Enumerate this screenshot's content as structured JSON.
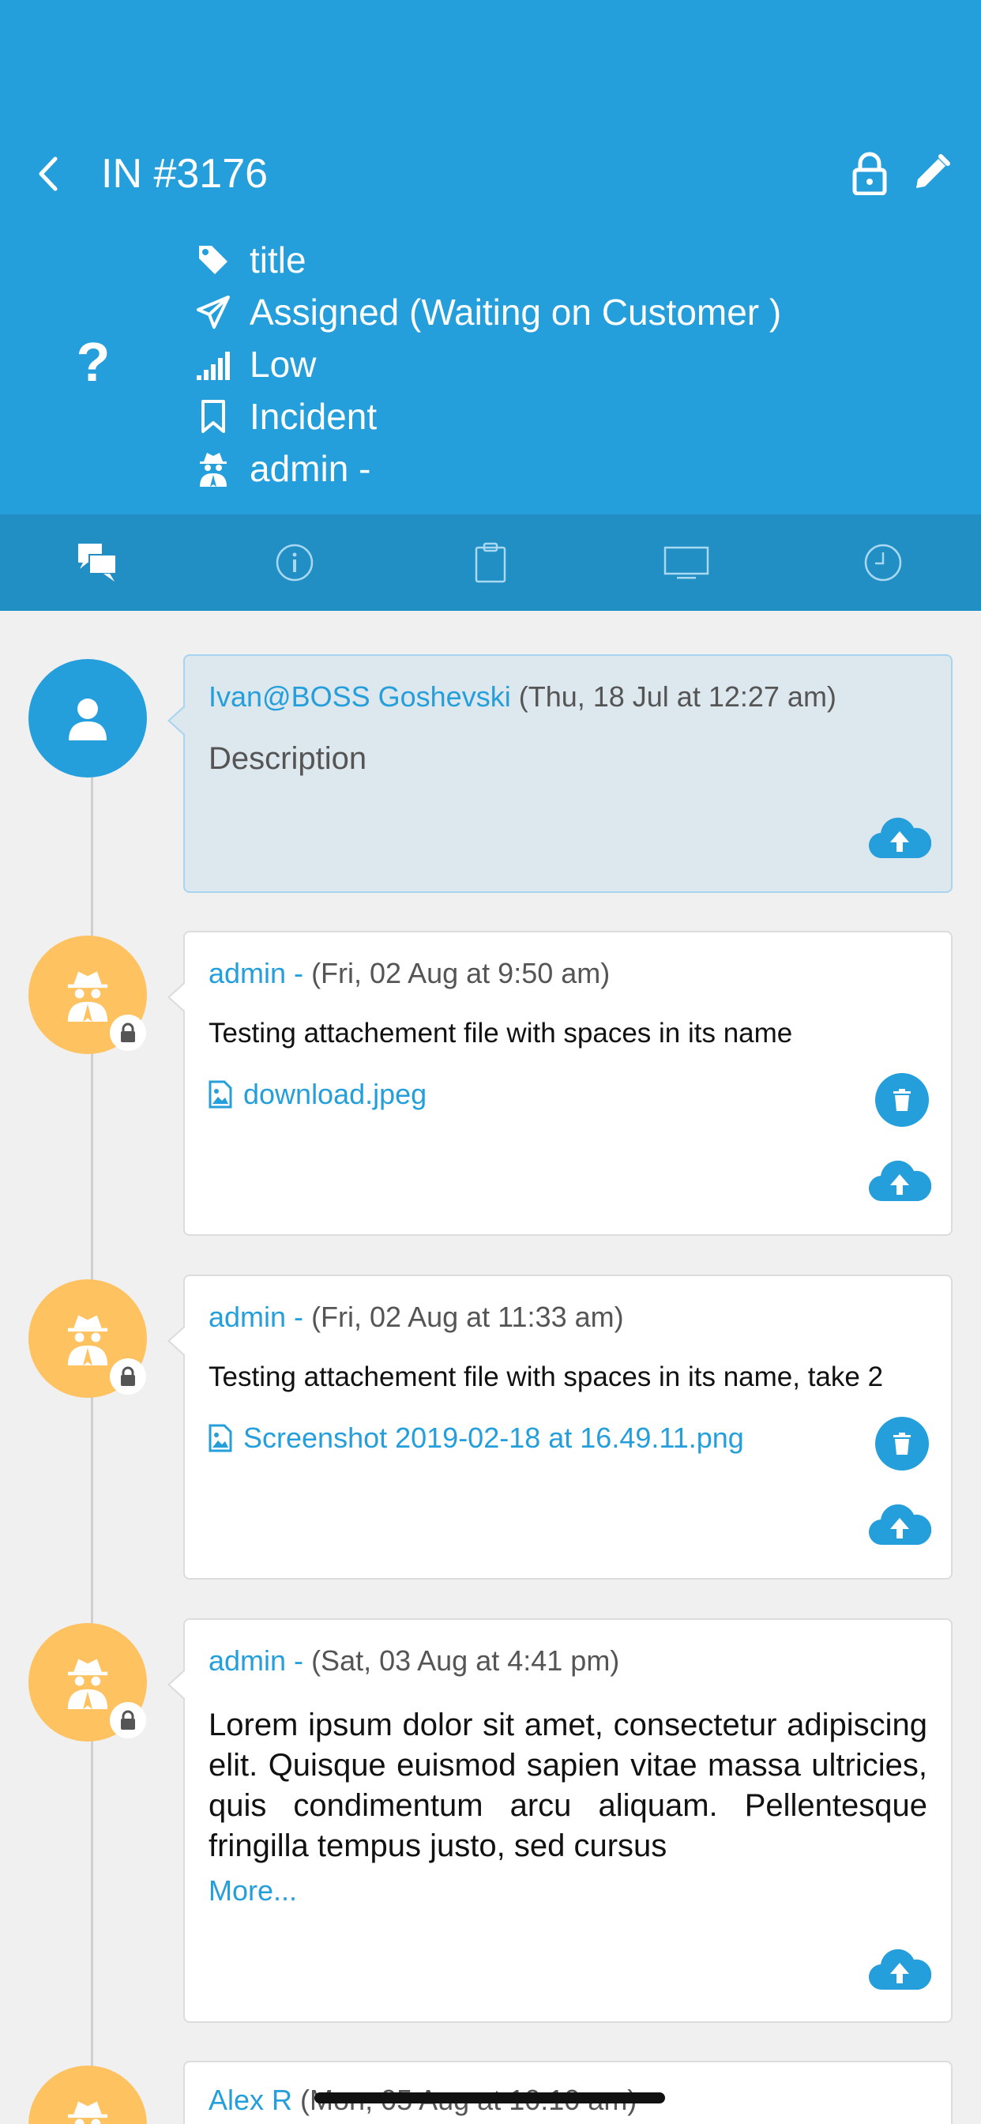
{
  "header": {
    "ticket_id": "IN #3176",
    "status_icon_glyph": "?",
    "meta": {
      "title": "title",
      "status": "Assigned (Waiting on Customer )",
      "priority": "Low",
      "type": "Incident",
      "agent": "admin -"
    },
    "colors": {
      "primary": "#259fdb",
      "tabbar": "#218ec4"
    }
  },
  "tabs": [
    {
      "icon": "conversation-icon",
      "active": true
    },
    {
      "icon": "info-icon",
      "active": false
    },
    {
      "icon": "clipboard-icon",
      "active": false
    },
    {
      "icon": "monitor-icon",
      "active": false
    },
    {
      "icon": "clock-icon",
      "active": false
    }
  ],
  "timeline": [
    {
      "author": "Ivan@BOSS Goshevski",
      "timestamp": "(Thu, 18 Jul at 12:27 am)",
      "body": "Description",
      "kind": "description"
    },
    {
      "author": "admin -",
      "timestamp": "(Fri, 02 Aug at 9:50 am)",
      "body": "Testing attachement file with spaces in its name",
      "attachment": "download.jpeg",
      "private": true
    },
    {
      "author": "admin -",
      "timestamp": "(Fri, 02 Aug at 11:33 am)",
      "body": "Testing attachement file with spaces in its name, take 2",
      "attachment": "Screenshot 2019-02-18 at 16.49.11.png",
      "private": true
    },
    {
      "author": "admin -",
      "timestamp": "(Sat, 03 Aug at 4:41 pm)",
      "body": "Lorem ipsum dolor sit amet, consectetur adipiscing elit. Quisque euismod sapien vitae massa ultricies, quis condimentum arcu aliquam. Pellentesque fringilla tempus justo, sed cursus",
      "more_label": "More...",
      "private": true
    },
    {
      "author": "Alex R",
      "timestamp": "(Mon, 05 Aug at 10:10 am)"
    }
  ]
}
